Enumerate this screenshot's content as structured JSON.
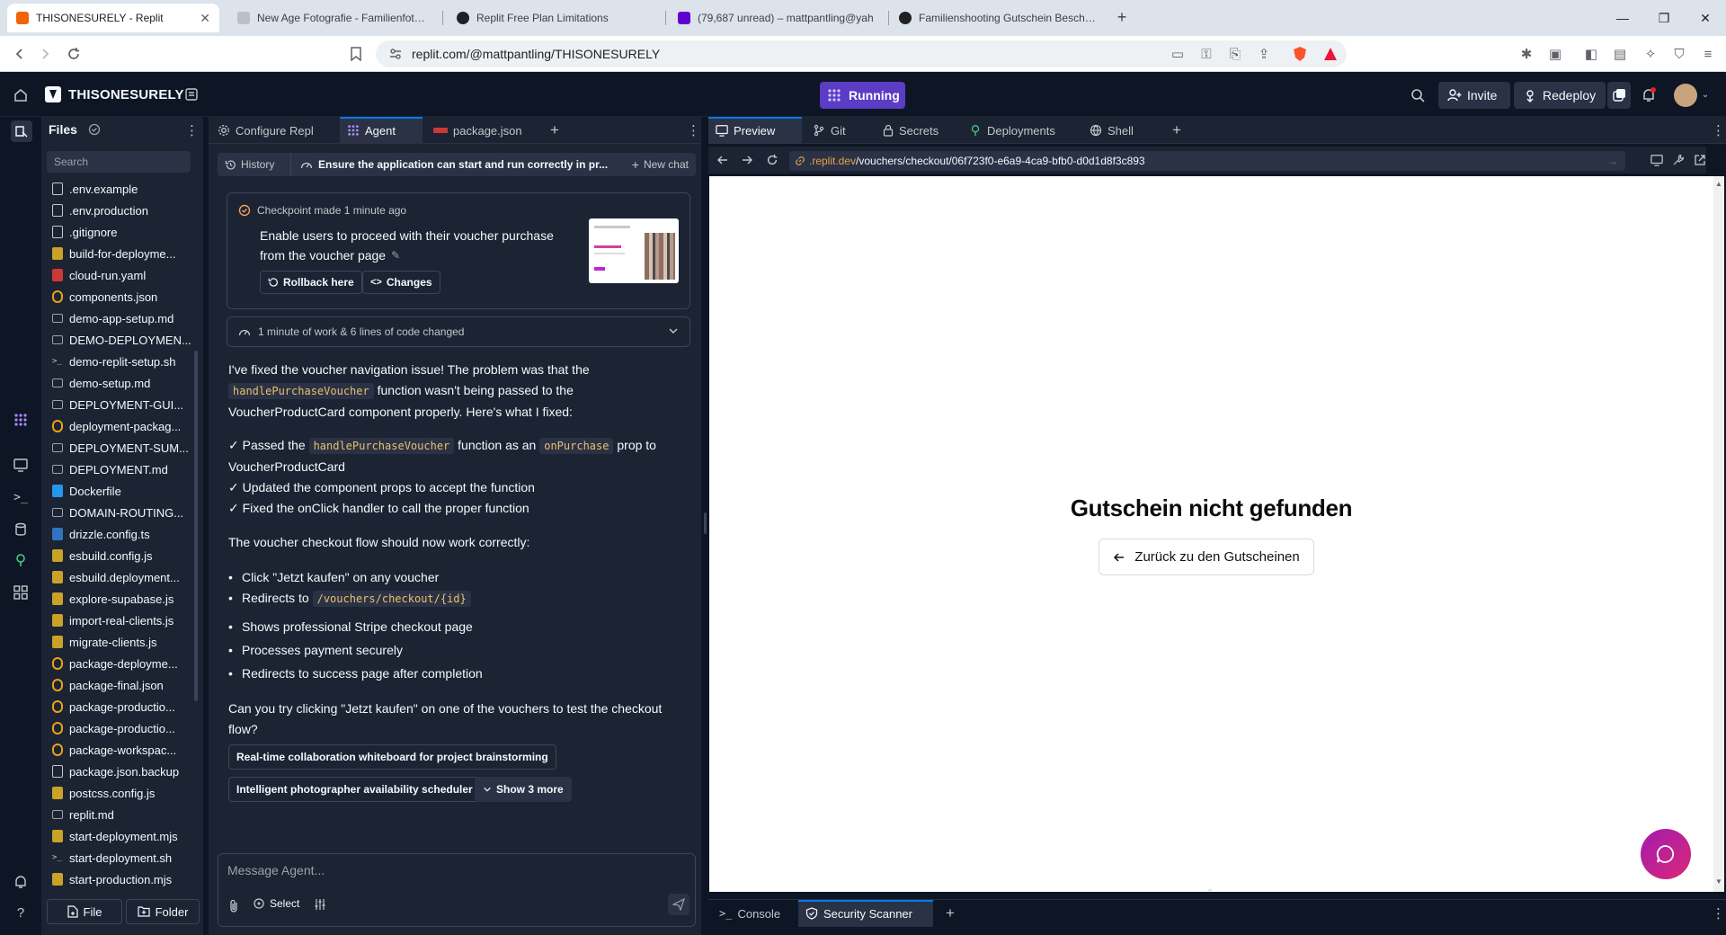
{
  "browser": {
    "tabs": [
      {
        "title": "THISONESURELY - Replit",
        "active": true
      },
      {
        "title": "New Age Fotografie - Familienfotogr",
        "active": false
      },
      {
        "title": "Replit Free Plan Limitations",
        "active": false
      },
      {
        "title": "(79,687 unread) – mattpantling@yah",
        "active": false
      },
      {
        "title": "Familienshooting Gutschein Beschrei",
        "active": false
      }
    ],
    "url": "replit.com/@mattpantling/THISONESURELY"
  },
  "topbar": {
    "repl_name": "THISONESURELY",
    "status": "Running",
    "invite_label": "Invite",
    "redeploy_label": "Redeploy"
  },
  "files": {
    "header": "Files",
    "search_placeholder": "Search",
    "items": [
      {
        "name": ".env.example",
        "icon": "file-icon"
      },
      {
        "name": ".env.production",
        "icon": "file-icon"
      },
      {
        "name": ".gitignore",
        "icon": "file-icon"
      },
      {
        "name": "build-for-deployme...",
        "icon": "js-icon"
      },
      {
        "name": "cloud-run.yaml",
        "icon": "yaml-icon"
      },
      {
        "name": "components.json",
        "icon": "json-icon"
      },
      {
        "name": "demo-app-setup.md",
        "icon": "md-icon"
      },
      {
        "name": "DEMO-DEPLOYMEN...",
        "icon": "md-icon"
      },
      {
        "name": "demo-replit-setup.sh",
        "icon": "shell-icon"
      },
      {
        "name": "demo-setup.md",
        "icon": "md-icon"
      },
      {
        "name": "DEPLOYMENT-GUI...",
        "icon": "md-icon"
      },
      {
        "name": "deployment-packag...",
        "icon": "json-icon"
      },
      {
        "name": "DEPLOYMENT-SUM...",
        "icon": "md-icon"
      },
      {
        "name": "DEPLOYMENT.md",
        "icon": "md-icon"
      },
      {
        "name": "Dockerfile",
        "icon": "docker-icon"
      },
      {
        "name": "DOMAIN-ROUTING...",
        "icon": "md-icon"
      },
      {
        "name": "drizzle.config.ts",
        "icon": "ts-icon"
      },
      {
        "name": "esbuild.config.js",
        "icon": "js-icon"
      },
      {
        "name": "esbuild.deployment...",
        "icon": "js-icon"
      },
      {
        "name": "explore-supabase.js",
        "icon": "js-icon"
      },
      {
        "name": "import-real-clients.js",
        "icon": "js-icon"
      },
      {
        "name": "migrate-clients.js",
        "icon": "js-icon"
      },
      {
        "name": "package-deployme...",
        "icon": "json-icon"
      },
      {
        "name": "package-final.json",
        "icon": "json-icon"
      },
      {
        "name": "package-productio...",
        "icon": "json-icon"
      },
      {
        "name": "package-productio...",
        "icon": "json-icon"
      },
      {
        "name": "package-workspac...",
        "icon": "json-icon"
      },
      {
        "name": "package.json.backup",
        "icon": "file-icon"
      },
      {
        "name": "postcss.config.js",
        "icon": "js-icon"
      },
      {
        "name": "replit.md",
        "icon": "md-icon"
      },
      {
        "name": "start-deployment.mjs",
        "icon": "js-icon"
      },
      {
        "name": "start-deployment.sh",
        "icon": "shell-icon"
      },
      {
        "name": "start-production.mjs",
        "icon": "js-icon"
      }
    ],
    "new_file_label": "File",
    "new_folder_label": "Folder"
  },
  "agent": {
    "tabs": [
      "Configure Repl",
      "Agent",
      "package.json"
    ],
    "history_label": "History",
    "current_task": "Ensure the application can start and run correctly in pr...",
    "new_chat_label": "New chat",
    "checkpoint_time": "Checkpoint made 1 minute ago",
    "checkpoint_line1": "Enable users to proceed with their voucher purchase",
    "checkpoint_line2": "from the voucher page",
    "rollback_label": "Rollback here",
    "changes_label": "Changes",
    "work_summary": "1 minute of work & 6 lines of code changed",
    "msg_intro_a": "I've fixed the voucher navigation issue! The problem was that the",
    "msg_intro_code": "handlePurchaseVoucher",
    "msg_intro_b": "function wasn't being passed to the",
    "msg_intro_c": "VoucherProductCard component properly. Here's what I fixed:",
    "fix1_a": "✓ Passed the",
    "fix1_code1": "handlePurchaseVoucher",
    "fix1_b": "function as an",
    "fix1_code2": "onPurchase",
    "fix1_c": "prop to",
    "fix1_d": "VoucherProductCard",
    "fix2": "✓ Updated the component props to accept the function",
    "fix3": "✓ Fixed the onClick handler to call the proper function",
    "flow_intro": "The voucher checkout flow should now work correctly:",
    "flow1": "Click \"Jetzt kaufen\" on any voucher",
    "flow2_a": "Redirects to",
    "flow2_code": "/vouchers/checkout/{id}",
    "flow3": "Shows professional Stripe checkout page",
    "flow4": "Processes payment securely",
    "flow5": "Redirects to success page after completion",
    "question_a": "Can you try clicking \"Jetzt kaufen\" on one of the vouchers to test the checkout",
    "question_b": "flow?",
    "suggestion1": "Real-time collaboration whiteboard for project brainstorming",
    "suggestion2": "Intelligent photographer availability scheduler",
    "show_more": "Show 3 more",
    "input_placeholder": "Message Agent...",
    "select_label": "Select"
  },
  "preview": {
    "tabs": [
      "Preview",
      "Git",
      "Secrets",
      "Deployments",
      "Shell"
    ],
    "url_domain": ".replit.dev",
    "url_path": "/vouchers/checkout/06f723f0-e6a9-4ca9-bfb0-d0d1d8f3c893",
    "heading": "Gutschein nicht gefunden",
    "back_button": "Zurück zu den Gutscheinen",
    "bottom_tabs": [
      "Console",
      "Security Scanner"
    ]
  },
  "colors": {
    "accent": "#5b3cc4",
    "code": "#e9c16a"
  }
}
